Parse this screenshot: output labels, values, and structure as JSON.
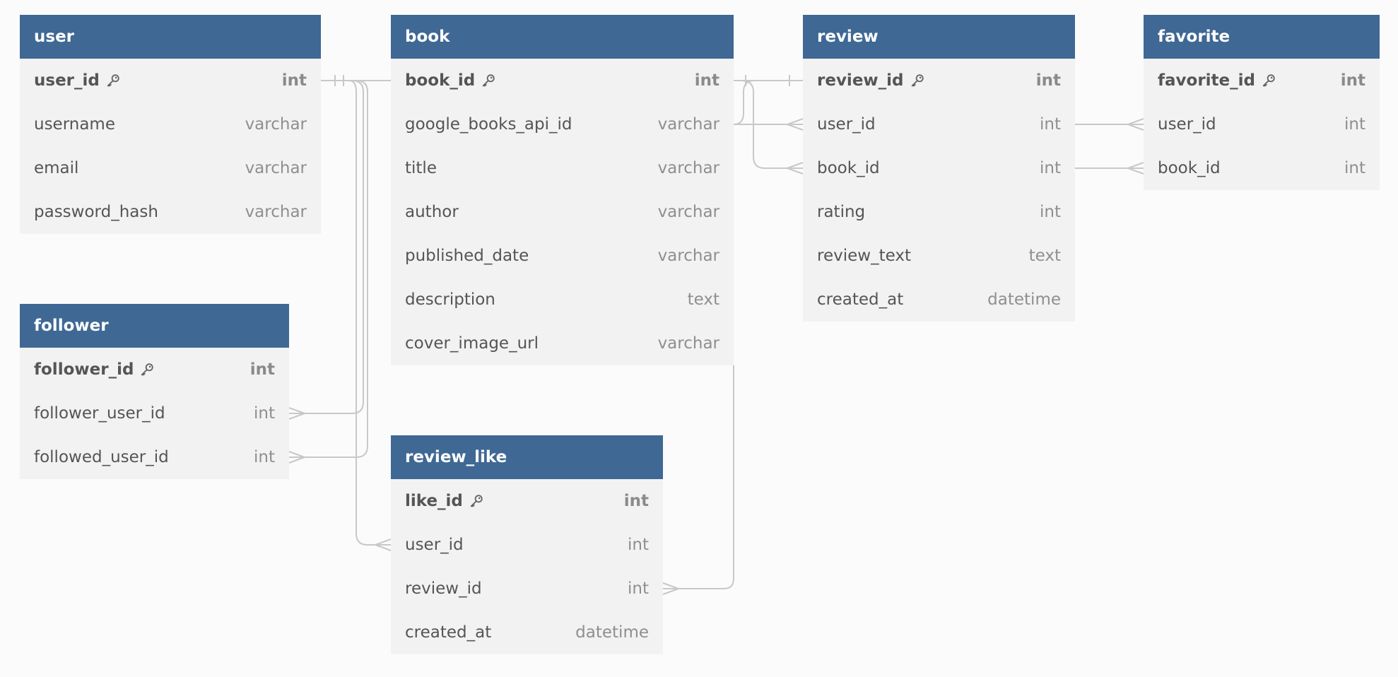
{
  "tables": [
    {
      "key": "user",
      "name": "user",
      "fields": [
        {
          "name": "user_id",
          "type": "int",
          "pk": true
        },
        {
          "name": "username",
          "type": "varchar",
          "pk": false
        },
        {
          "name": "email",
          "type": "varchar",
          "pk": false
        },
        {
          "name": "password_hash",
          "type": "varchar",
          "pk": false
        }
      ]
    },
    {
      "key": "book",
      "name": "book",
      "fields": [
        {
          "name": "book_id",
          "type": "int",
          "pk": true
        },
        {
          "name": "google_books_api_id",
          "type": "varchar",
          "pk": false
        },
        {
          "name": "title",
          "type": "varchar",
          "pk": false
        },
        {
          "name": "author",
          "type": "varchar",
          "pk": false
        },
        {
          "name": "published_date",
          "type": "varchar",
          "pk": false
        },
        {
          "name": "description",
          "type": "text",
          "pk": false
        },
        {
          "name": "cover_image_url",
          "type": "varchar",
          "pk": false
        }
      ]
    },
    {
      "key": "review",
      "name": "review",
      "fields": [
        {
          "name": "review_id",
          "type": "int",
          "pk": true
        },
        {
          "name": "user_id",
          "type": "int",
          "pk": false
        },
        {
          "name": "book_id",
          "type": "int",
          "pk": false
        },
        {
          "name": "rating",
          "type": "int",
          "pk": false
        },
        {
          "name": "review_text",
          "type": "text",
          "pk": false
        },
        {
          "name": "created_at",
          "type": "datetime",
          "pk": false
        }
      ]
    },
    {
      "key": "favorite",
      "name": "favorite",
      "fields": [
        {
          "name": "favorite_id",
          "type": "int",
          "pk": true
        },
        {
          "name": "user_id",
          "type": "int",
          "pk": false
        },
        {
          "name": "book_id",
          "type": "int",
          "pk": false
        }
      ]
    },
    {
      "key": "follower",
      "name": "follower",
      "fields": [
        {
          "name": "follower_id",
          "type": "int",
          "pk": true
        },
        {
          "name": "follower_user_id",
          "type": "int",
          "pk": false
        },
        {
          "name": "followed_user_id",
          "type": "int",
          "pk": false
        }
      ]
    },
    {
      "key": "review_like",
      "name": "review_like",
      "fields": [
        {
          "name": "like_id",
          "type": "int",
          "pk": true
        },
        {
          "name": "user_id",
          "type": "int",
          "pk": false
        },
        {
          "name": "review_id",
          "type": "int",
          "pk": false
        },
        {
          "name": "created_at",
          "type": "datetime",
          "pk": false
        }
      ]
    }
  ],
  "relations": [
    {
      "from": "user.user_id",
      "to": "follower.follower_user_id",
      "from_card": "one",
      "to_card": "many"
    },
    {
      "from": "user.user_id",
      "to": "follower.followed_user_id",
      "from_card": "one",
      "to_card": "many"
    },
    {
      "from": "user.user_id",
      "to": "review_like.user_id",
      "from_card": "one",
      "to_card": "many"
    },
    {
      "from": "book.book_id",
      "to": "review.book_id",
      "from_card": "one",
      "to_card": "many"
    },
    {
      "from": "review.review_id",
      "to": "review_like.review_id",
      "from_card": "one",
      "to_card": "many"
    },
    {
      "from": "review.user_id",
      "to": "favorite.user_id",
      "from_card": "many",
      "to_card": "many"
    },
    {
      "from": "review.book_id",
      "to": "favorite.book_id",
      "from_card": "many",
      "to_card": "many"
    }
  ],
  "colors": {
    "header_bg": "#3f6894",
    "header_text": "#ffffff",
    "body_bg": "#f2f2f2",
    "field_text": "#555555",
    "type_text": "#8f8f8f",
    "line": "#c8c8c8",
    "canvas_bg": "#fbfbfb"
  },
  "icons": {
    "primary_key": "key-icon"
  }
}
